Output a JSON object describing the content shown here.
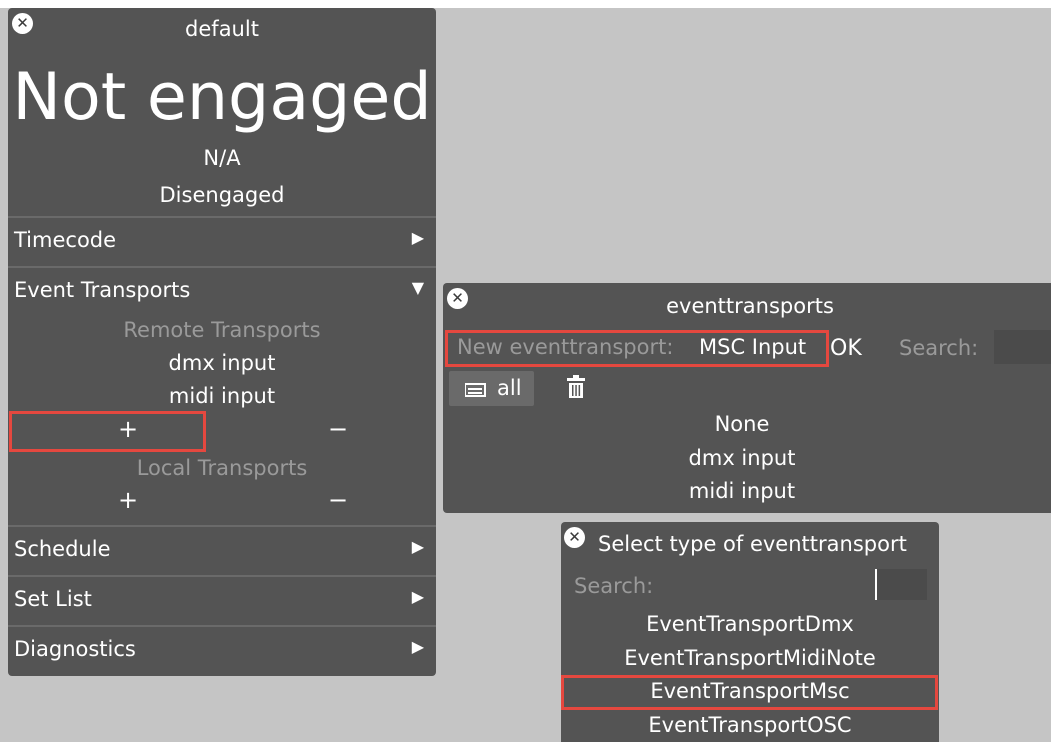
{
  "main_panel": {
    "title": "default",
    "status_big": "Not engaged",
    "status_na": "N/A",
    "status_state": "Disengaged",
    "sections": {
      "timecode": "Timecode",
      "event_transports": "Event Transports",
      "schedule": "Schedule",
      "set_list": "Set List",
      "diagnostics": "Diagnostics"
    },
    "remote_transports_label": "Remote Transports",
    "remote_items": [
      "dmx input",
      "midi input"
    ],
    "local_transports_label": "Local Transports",
    "add_symbol": "+",
    "remove_symbol": "−",
    "expand_collapsed": "▶",
    "expand_open": "▼"
  },
  "eventtransports_panel": {
    "title": "eventtransports",
    "new_label": "New eventtransport:",
    "new_value": "MSC Input",
    "ok_label": "OK",
    "search_label": "Search:",
    "filter_all": "all",
    "items": [
      "None",
      "dmx input",
      "midi input"
    ]
  },
  "select_type_panel": {
    "title": "Select type of eventtransport",
    "search_label": "Search:",
    "options": [
      "EventTransportDmx",
      "EventTransportMidiNote",
      "EventTransportMsc",
      "EventTransportOSC"
    ]
  },
  "colors": {
    "panel": "#545454",
    "highlight": "#e5483f",
    "background": "#c5c5c5"
  },
  "icons": [
    "close-icon",
    "chevron-right-icon",
    "chevron-down-icon",
    "list-icon",
    "trash-icon"
  ]
}
